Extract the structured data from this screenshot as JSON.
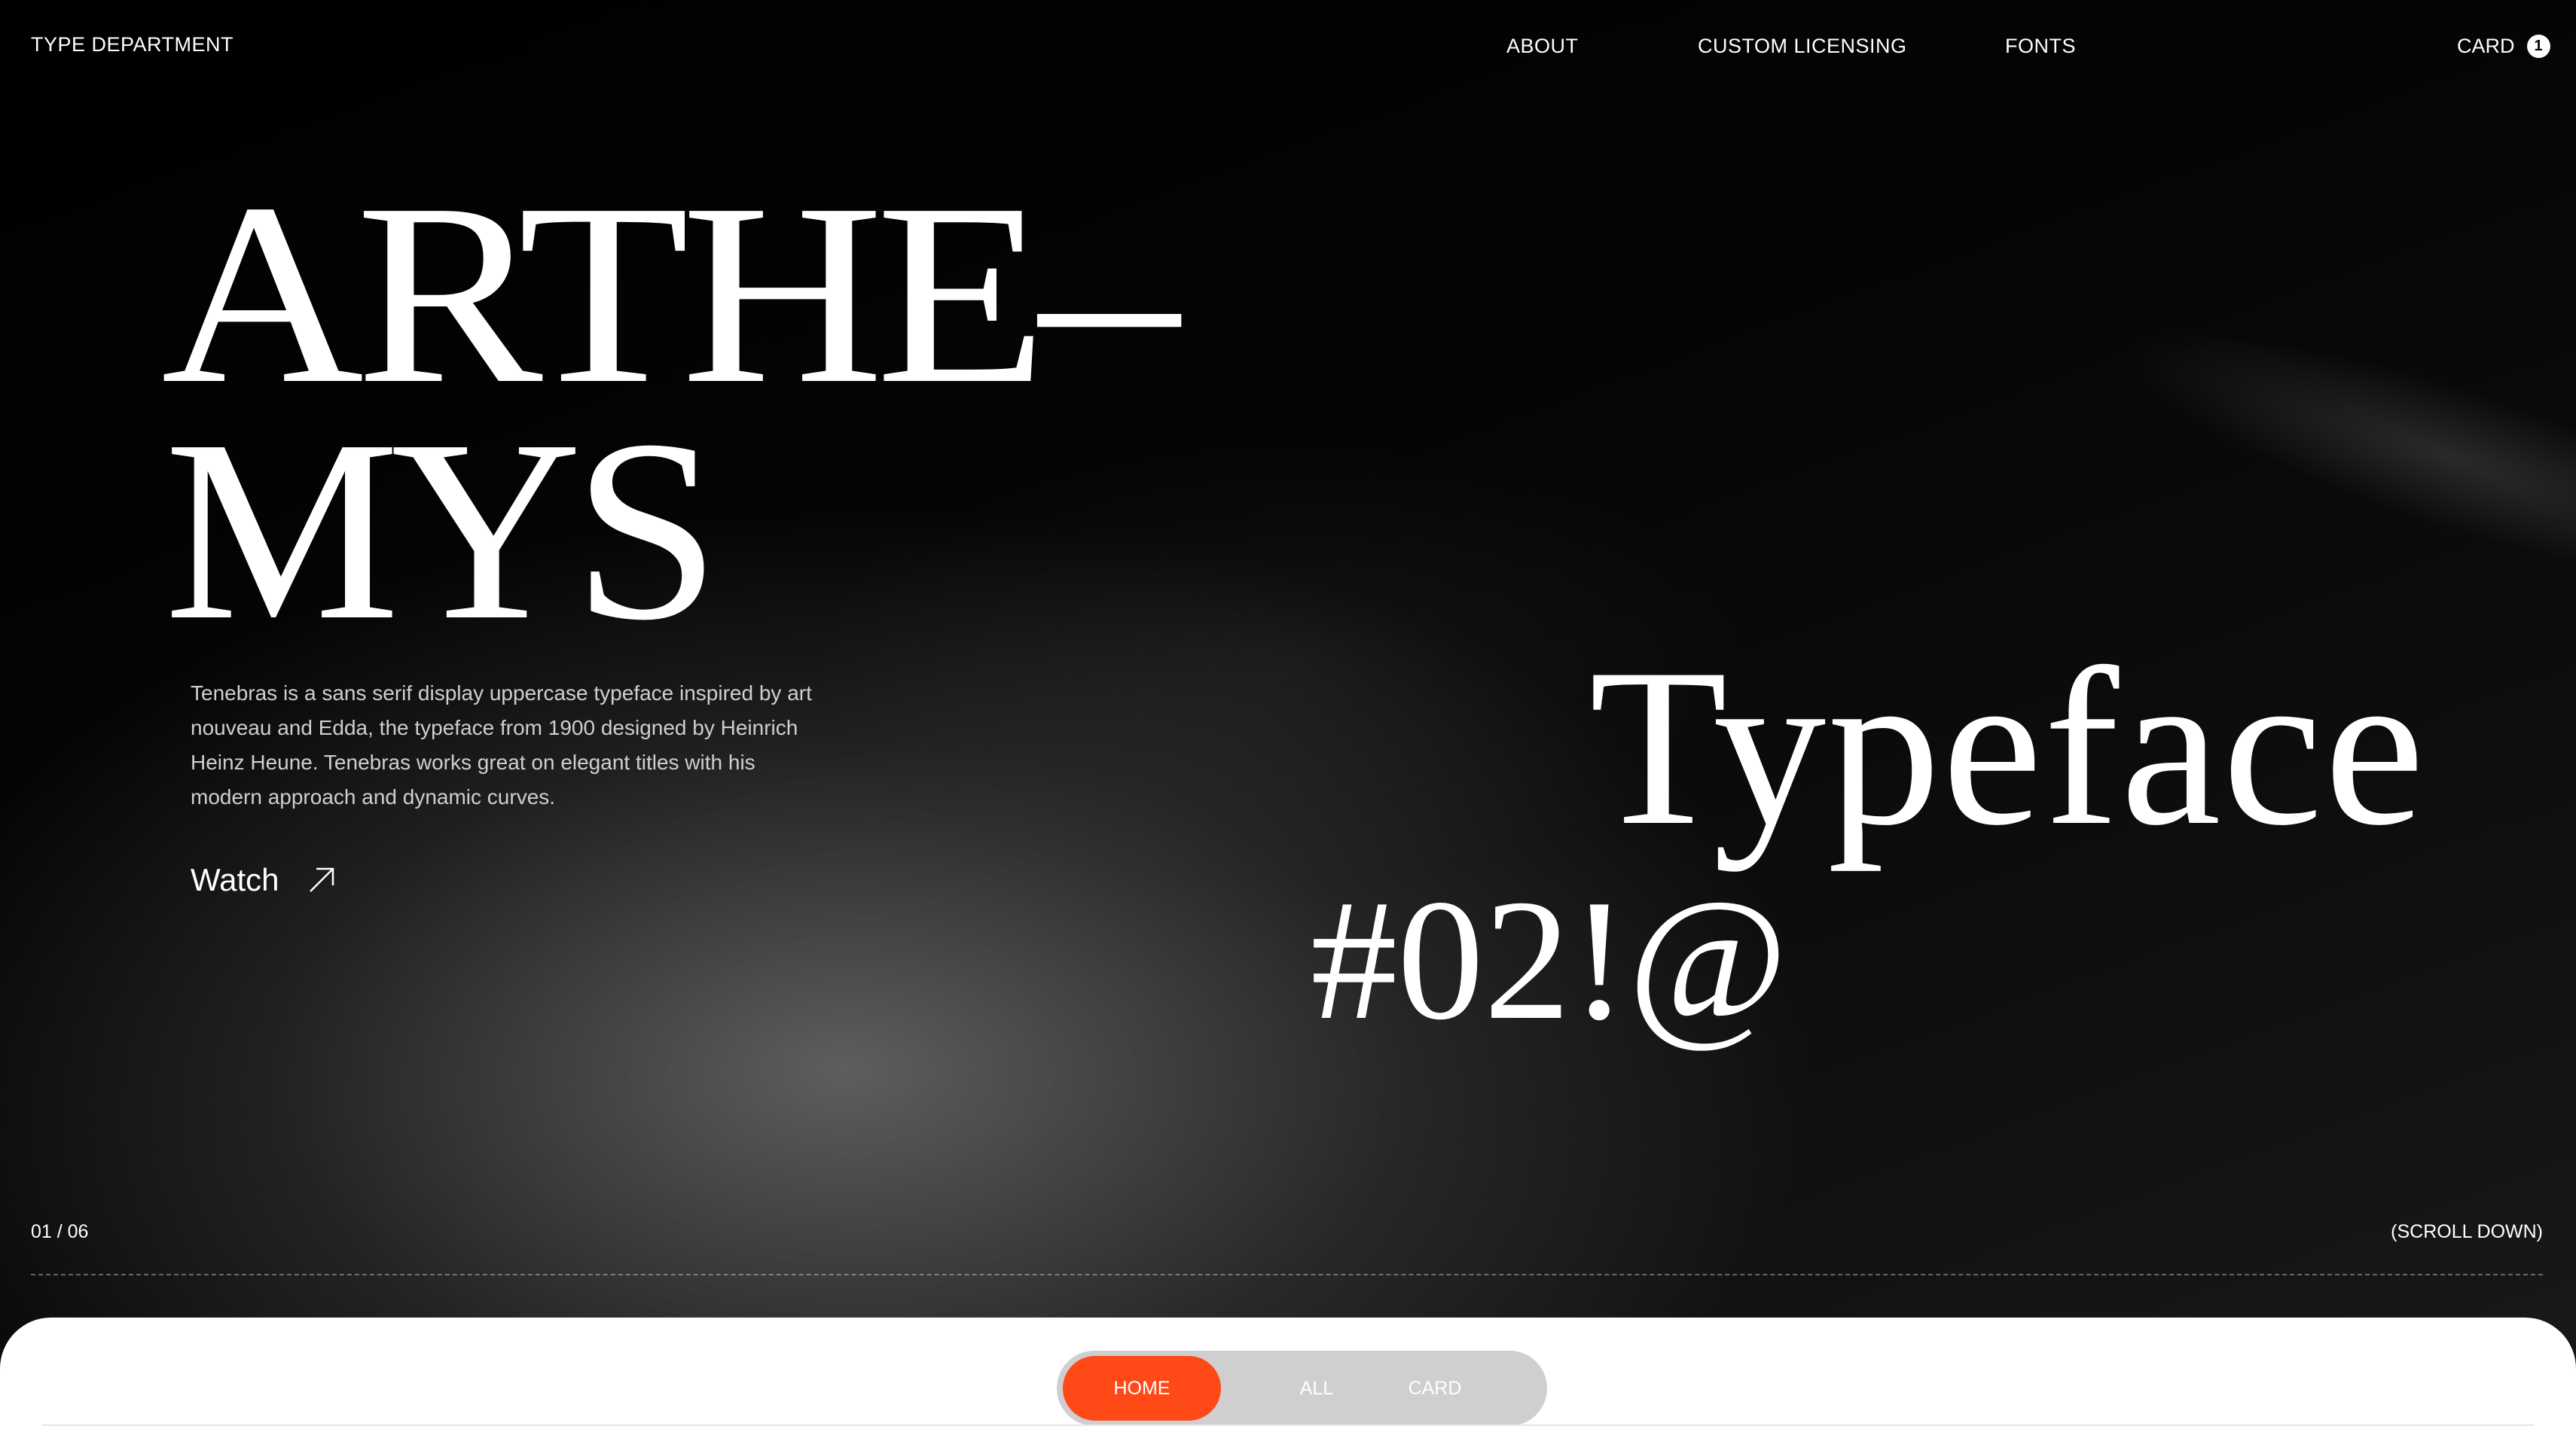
{
  "header": {
    "brand": "TYPE DEPARTMENT",
    "nav": [
      "ABOUT",
      "CUSTOM LICENSING",
      "FONTS"
    ],
    "cart_label": "CARD",
    "cart_count": "1"
  },
  "hero": {
    "title_line1": "ARTHE–",
    "title_line2": "MYS",
    "typeface_label": "Typeface",
    "glyphs": "#02!@",
    "description": "Tenebras is a sans serif display uppercase typeface inspired by art nouveau and Edda, the typeface from 1900 designed by Heinrich Heinz Heune. Tenebras works great on elegant titles with his modern approach and dynamic curves.",
    "watch_label": "Watch",
    "watch_icon": "arrow-up-right-icon"
  },
  "footer_bar": {
    "counter": "01 / 06",
    "scroll_label": "(SCROLL DOWN)"
  },
  "tabs": {
    "items": [
      "HOME",
      "ALL",
      "CARD"
    ],
    "active": "HOME",
    "accent_color": "#ff4a17"
  }
}
